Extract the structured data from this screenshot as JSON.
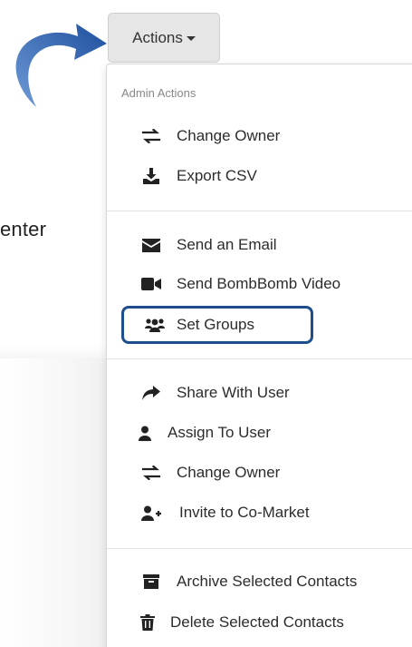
{
  "left_text": "enter",
  "actions_button": {
    "label": "Actions"
  },
  "menu": {
    "header": "Admin Actions",
    "sections": [
      {
        "items": [
          {
            "label": "Change Owner",
            "icon": "exchange-icon"
          },
          {
            "label": "Export CSV",
            "icon": "download-icon"
          }
        ]
      },
      {
        "items": [
          {
            "label": "Send an Email",
            "icon": "envelope-icon"
          },
          {
            "label": "Send BombBomb Video",
            "icon": "video-camera-icon"
          },
          {
            "label": "Set Groups",
            "icon": "users-icon",
            "highlighted": true
          }
        ]
      },
      {
        "items": [
          {
            "label": "Share With User",
            "icon": "share-icon"
          },
          {
            "label": "Assign To User",
            "icon": "user-icon"
          },
          {
            "label": "Change Owner",
            "icon": "exchange-icon"
          },
          {
            "label": "Invite to Co-Market",
            "icon": "user-plus-icon"
          }
        ]
      },
      {
        "items": [
          {
            "label": "Archive Selected Contacts",
            "icon": "archive-icon"
          },
          {
            "label": "Delete Selected Contacts",
            "icon": "trash-icon"
          }
        ]
      }
    ]
  },
  "colors": {
    "highlight_border": "#1e4e8c",
    "arrow": "#2a5da8",
    "button_bg": "#e6e6e6"
  }
}
